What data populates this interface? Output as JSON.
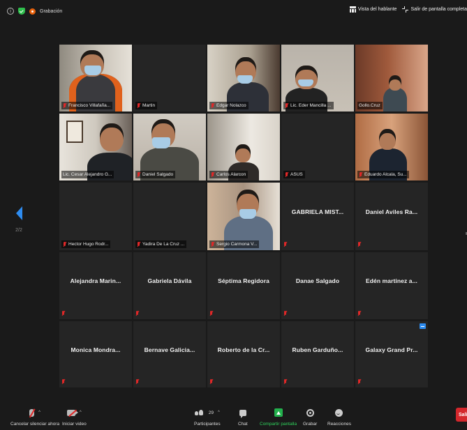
{
  "top_bar": {
    "recording_label": "Grabación",
    "speaker_view_label": "Vista del hablante",
    "exit_fullscreen_label": "Salir de pantalla completa"
  },
  "navigation": {
    "page_indicator": "2/2"
  },
  "participants": [
    {
      "name": "Francisco Villafaña",
      "label": "Francisco Villafaña...",
      "video": true,
      "muted": true,
      "scene": "a"
    },
    {
      "name": "Martin",
      "label": "Martin",
      "video": false,
      "show_bar": true,
      "muted": true
    },
    {
      "name": "Edgar Nolazco",
      "label": "Edgar Nolazco",
      "video": true,
      "muted": true,
      "scene": "b"
    },
    {
      "name": "Lic. Eder Mancilla",
      "label": "Lic. Eder Mancilla ...",
      "video": true,
      "muted": true,
      "scene": "c"
    },
    {
      "name": "Gollo.Cruz",
      "label": "Gollo.Cruz",
      "video": true,
      "muted": false,
      "scene": "d"
    },
    {
      "name": "Lic. Cesar Alejandro",
      "label": "Lic. Cesar Alejandro G...",
      "video": true,
      "muted": false,
      "scene": "e"
    },
    {
      "name": "Daniel Salgado",
      "label": "Daniel Salgado",
      "video": true,
      "muted": true,
      "scene": "f"
    },
    {
      "name": "Carlos Alarcon",
      "label": "Carlos Alarcon",
      "video": true,
      "muted": true,
      "scene": "g"
    },
    {
      "name": "ASUS",
      "label": "ASUS",
      "video": false,
      "show_bar": true,
      "muted": true
    },
    {
      "name": "Eduardo Alcala",
      "label": "Eduardo Alcala, Su...",
      "video": true,
      "muted": true,
      "scene": "h"
    },
    {
      "name": "Hector Hugo Rodr",
      "label": "Hector Hugo Rodr...",
      "video": false,
      "show_bar": true,
      "muted": true
    },
    {
      "name": "Yadira De La Cruz",
      "label": "Yadira De La Cruz ...",
      "video": false,
      "show_bar": true,
      "muted": true
    },
    {
      "name": "Sergio Carmona",
      "label": "Sergio Carmona V...",
      "video": true,
      "muted": true,
      "scene": "i"
    },
    {
      "name": "GABRIELA MIST...",
      "center": "GABRIELA MIST...",
      "video": false,
      "muted": true
    },
    {
      "name": "Daniel Aviles Ra...",
      "center": "Daniel Aviles Ra...",
      "video": false,
      "muted": true
    },
    {
      "name": "Alejandra Marin...",
      "center": "Alejandra Marin...",
      "video": false,
      "muted": true
    },
    {
      "name": "Gabriela Dávila",
      "center": "Gabriela Dávila",
      "video": false,
      "muted": true
    },
    {
      "name": "Séptima Regidora",
      "center": "Séptima Regidora",
      "video": false,
      "muted": true
    },
    {
      "name": "Danae Salgado",
      "center": "Danae Salgado",
      "video": false,
      "muted": true
    },
    {
      "name": "Edén martinez a...",
      "center": "Edén martinez a...",
      "video": false,
      "muted": true
    },
    {
      "name": "Monica Mondra...",
      "center": "Monica Mondra...",
      "video": false,
      "muted": true
    },
    {
      "name": "Bernave Galicia...",
      "center": "Bernave Galicia...",
      "video": false,
      "muted": true
    },
    {
      "name": "Roberto de la Cr...",
      "center": "Roberto de la Cr...",
      "video": false,
      "muted": true
    },
    {
      "name": "Ruben Garduño...",
      "center": "Ruben Garduño...",
      "video": false,
      "muted": true
    },
    {
      "name": "Galaxy Grand Pr...",
      "center": "Galaxy Grand Pr...",
      "video": false,
      "muted": true,
      "pinned": true
    }
  ],
  "toolbar": {
    "mute_label": "Cancelar silenciar ahora",
    "video_label": "Iniciar video",
    "participants_label": "Participantes",
    "participants_count": "29",
    "chat_label": "Chat",
    "share_label": "Compartir pantalla",
    "record_label": "Grabar",
    "reactions_label": "Reacciones",
    "leave_label": "Salir"
  },
  "colors": {
    "accent": "#2e8cf0",
    "share_green": "#23b14d",
    "muted_red": "#e02828",
    "leave_red": "#d4272c",
    "recording_orange": "#e8620c"
  }
}
